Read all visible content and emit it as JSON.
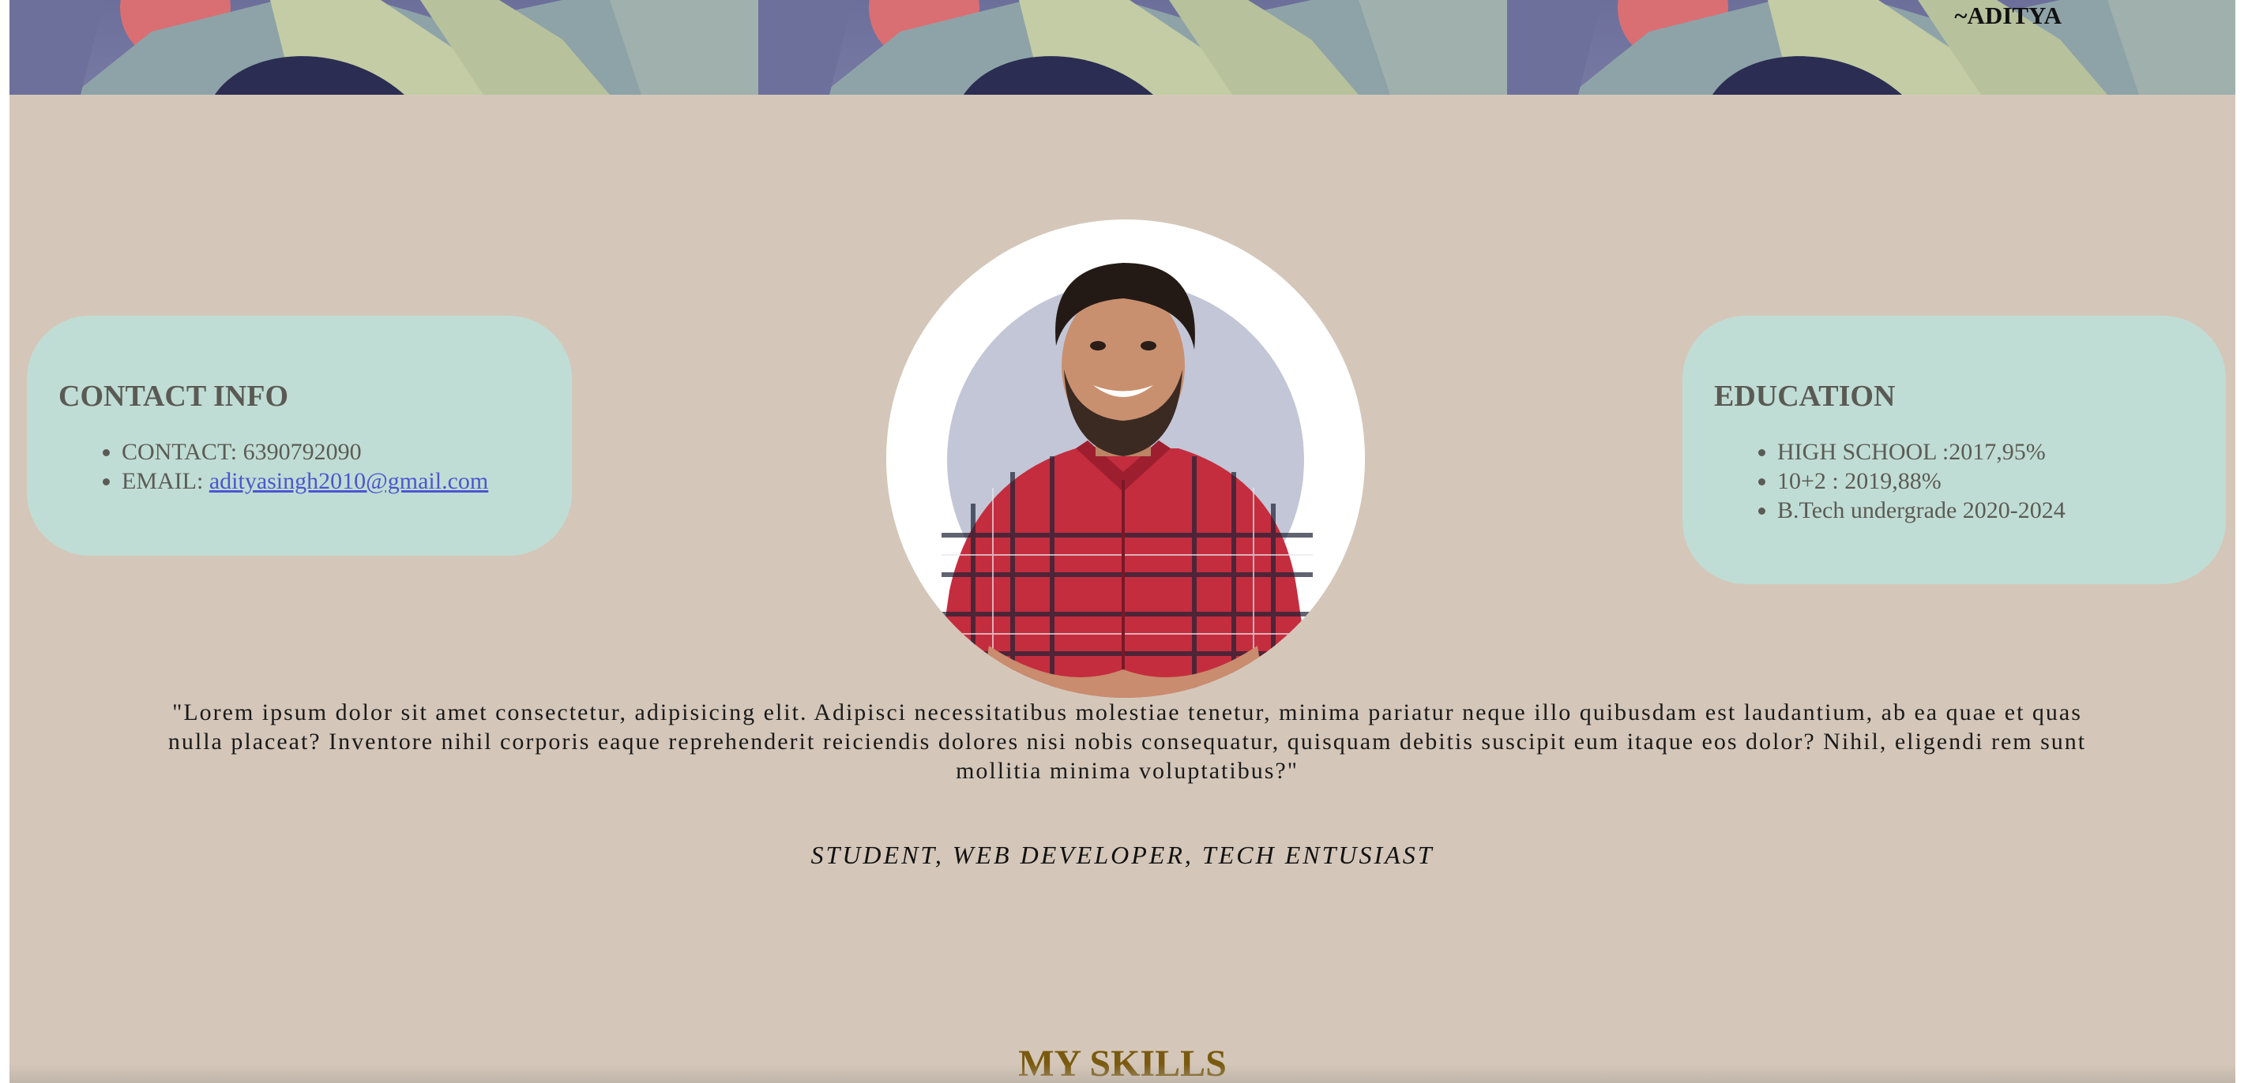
{
  "header": {
    "signature": "~ADITYA"
  },
  "contact": {
    "title": "CONTACT INFO",
    "phone_label": "CONTACT:",
    "phone": "6390792090",
    "email_label": "EMAIL:",
    "email": "adityasingh2010@gmail.com"
  },
  "education": {
    "title": "EDUCATION",
    "items": [
      "HIGH SCHOOL :2017,95%",
      "10+2 : 2019,88%",
      "B.Tech undergrade 2020-2024"
    ]
  },
  "about": {
    "quote": "\"Lorem ipsum dolor sit amet consectetur, adipisicing elit. Adipisci necessitatibus molestiae tenetur, minima pariatur neque illo quibusdam est laudantium, ab ea quae et quas nulla placeat? Inventore nihil corporis eaque reprehenderit reiciendis dolores nisi nobis consequatur, quisquam debitis suscipit eum itaque eos dolor? Nihil, eligendi rem sunt mollitia minima voluptatibus?\"",
    "tagline": "STUDENT, WEB DEVELOPER, TECH ENTUSIAST"
  },
  "skills": {
    "heading": "MY SKILLS"
  },
  "colors": {
    "page_background": "#d4c7b9",
    "card_background": "#c0ddd5",
    "link": "#4e55cf",
    "skills_heading": "#7a5a10"
  }
}
